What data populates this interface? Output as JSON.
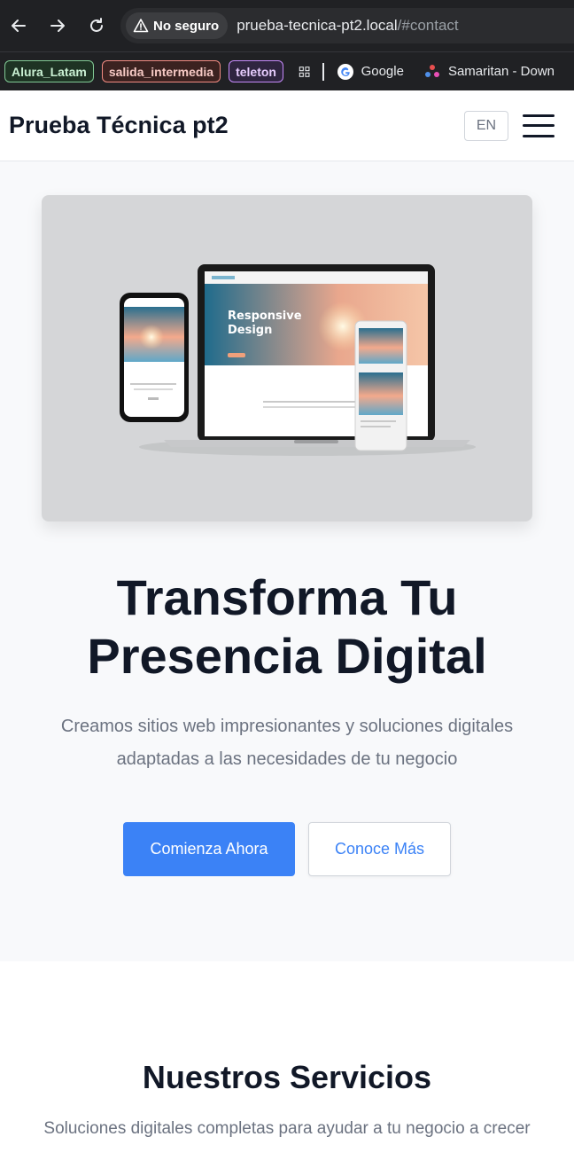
{
  "browser": {
    "security_label": "No seguro",
    "url_host": "prueba-tecnica-pt2.local",
    "url_path": "/#contact",
    "bookmarks": [
      {
        "label": "Alura_Latam",
        "color": "#81c995"
      },
      {
        "label": "salida_intermedia",
        "color": "#f28b82"
      },
      {
        "label": "teleton",
        "color": "#c58af9"
      }
    ],
    "links": [
      {
        "label": "Google",
        "icon": "google-icon"
      },
      {
        "label": "Samaritan - Down",
        "icon": "samaritan-icon"
      }
    ]
  },
  "header": {
    "brand": "Prueba Técnica pt2",
    "lang": "EN",
    "menu_icon": "hamburger-icon"
  },
  "hero": {
    "image": {
      "heading_line1": "Responsive",
      "heading_line2": "Design"
    },
    "title_line1": "Transforma Tu",
    "title_line2": "Presencia Digital",
    "subtitle_line1": "Creamos sitios web impresionantes y soluciones digitales",
    "subtitle_line2": "adaptadas a las necesidades de tu negocio",
    "cta_primary": "Comienza Ahora",
    "cta_secondary": "Conoce Más",
    "accent": "#3b82f6"
  },
  "services": {
    "title": "Nuestros Servicios",
    "subtitle": "Soluciones digitales completas para ayudar a tu negocio a crecer"
  }
}
